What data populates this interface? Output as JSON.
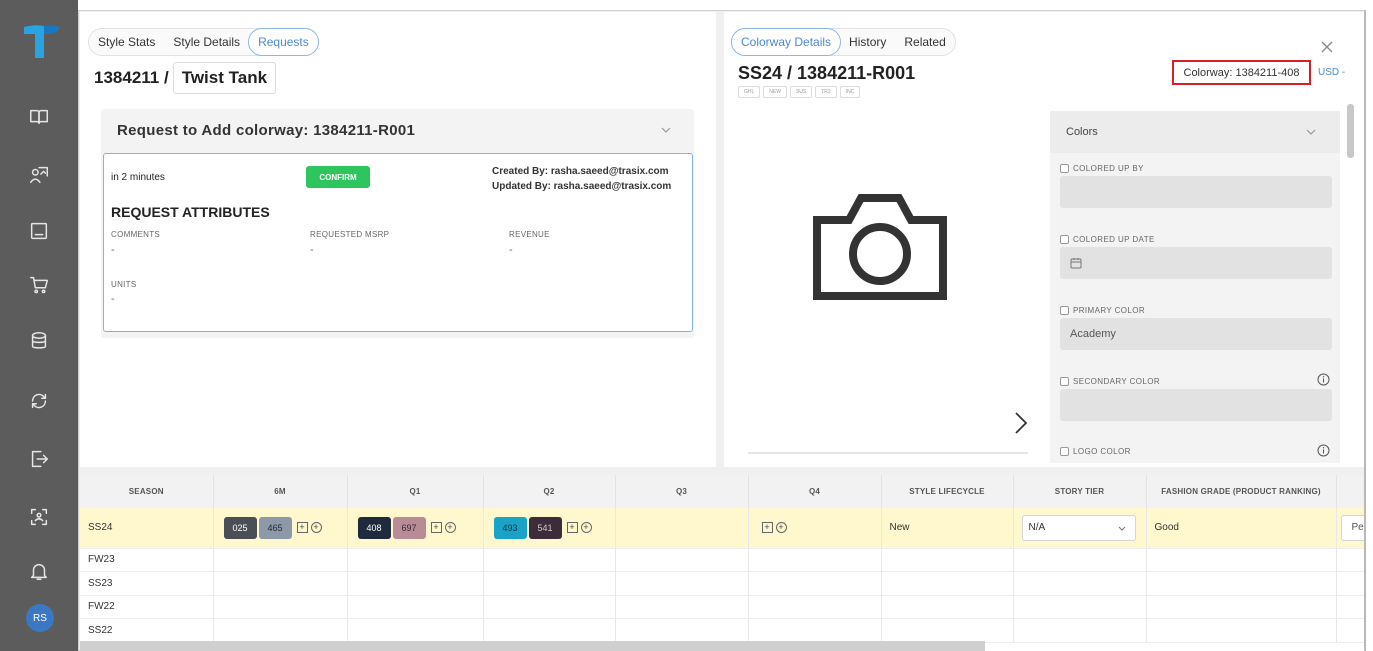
{
  "sidebar": {
    "avatar_initials": "RS",
    "items": [
      "book-icon",
      "user-chart-icon",
      "monitor-icon",
      "cart-icon",
      "database-icon",
      "sync-icon",
      "logout-icon",
      "scan-icon",
      "bell-icon"
    ]
  },
  "left": {
    "tabs": [
      "Style Stats",
      "Style Details",
      "Requests"
    ],
    "active_tab": "Requests",
    "style_number": "1384211 /",
    "style_name": "Twist Tank",
    "request": {
      "title": "Request to Add colorway: 1384211-R001",
      "eta": "in 2 minutes",
      "confirm_label": "CONFIRM",
      "created_by": "Created By: rasha.saeed@trasix.com",
      "updated_by": "Updated By: rasha.saeed@trasix.com",
      "attributes_title": "REQUEST ATTRIBUTES",
      "attributes": [
        {
          "label": "COMMENTS",
          "value": "-"
        },
        {
          "label": "REQUESTED MSRP",
          "value": "-"
        },
        {
          "label": "REVENUE",
          "value": "-"
        },
        {
          "label": "UNITS",
          "value": "-"
        }
      ]
    }
  },
  "right": {
    "tabs": [
      "Colorway Details",
      "History",
      "Related"
    ],
    "active_tab": "Colorway Details",
    "title": "SS24 / 1384211-R001",
    "badges": [
      "GHL",
      "NEW",
      "SUS",
      "TR2",
      "INC"
    ],
    "colorway_label": "Colorway: 1384211-408",
    "currency": "USD -",
    "colors_section": {
      "title": "Colors",
      "fields": [
        {
          "label": "COLORED UP BY",
          "value": ""
        },
        {
          "label": "COLORED UP DATE",
          "value": ""
        },
        {
          "label": "PRIMARY COLOR",
          "value": "Academy"
        },
        {
          "label": "SECONDARY COLOR",
          "value": ""
        },
        {
          "label": "LOGO COLOR",
          "value": ""
        }
      ]
    }
  },
  "table": {
    "headers": [
      "SEASON",
      "6M",
      "Q1",
      "Q2",
      "Q3",
      "Q4",
      "STYLE LIFECYCLE",
      "STORY TIER",
      "FASHION GRADE (PRODUCT RANKING)",
      ""
    ],
    "highlight_row": {
      "season": "SS24",
      "m6_chips": [
        {
          "code": "025",
          "bg": "#4a4f55",
          "fg": "#ffffff"
        },
        {
          "code": "465",
          "bg": "#8d99a8",
          "fg": "#1e2a3a"
        }
      ],
      "q1_chips": [
        {
          "code": "408",
          "bg": "#1f2a3d",
          "fg": "#ffffff"
        },
        {
          "code": "697",
          "bg": "#b88c97",
          "fg": "#3a2a30"
        }
      ],
      "q2_chips": [
        {
          "code": "493",
          "bg": "#1aa3c8",
          "fg": "#0c3a4a"
        },
        {
          "code": "541",
          "bg": "#3a2c38",
          "fg": "#e0c0cc"
        }
      ],
      "lifecycle": "New",
      "story_tier": "N/A",
      "fashion_grade": "Good",
      "extra": "Per"
    },
    "other_seasons": [
      "FW23",
      "SS23",
      "FW22",
      "SS22"
    ]
  },
  "colors": {
    "accent": "#4a8ad4",
    "confirm": "#2ec55e",
    "highlight": "#d61f26",
    "sidebar": "#5c5c5c"
  }
}
